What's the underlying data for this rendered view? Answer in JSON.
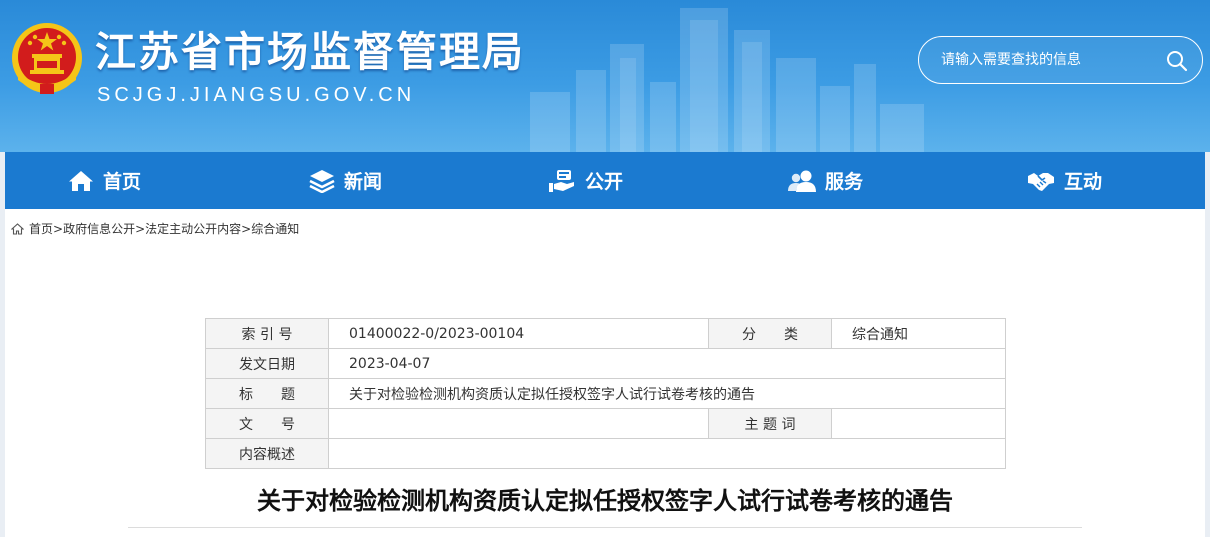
{
  "header": {
    "site_title": "江苏省市场监督管理局",
    "site_domain": "SCJGJ.JIANGSU.GOV.CN",
    "emblem_icon": "national-emblem-icon",
    "search_placeholder": "请输入需要查找的信息",
    "search_icon": "search-icon"
  },
  "nav": {
    "items": [
      {
        "label": "首页",
        "icon": "home-icon"
      },
      {
        "label": "新闻",
        "icon": "layers-icon"
      },
      {
        "label": "公开",
        "icon": "open-hand-icon"
      },
      {
        "label": "服务",
        "icon": "users-icon"
      },
      {
        "label": "互动",
        "icon": "handshake-icon"
      }
    ]
  },
  "breadcrumb": {
    "icon": "home-icon",
    "items": [
      "首页",
      "政府信息公开",
      "法定主动公开内容",
      "综合通知"
    ],
    "separator": ">"
  },
  "info_table": {
    "index_label": "索 引 号",
    "index_value": "01400022-0/2023-00104",
    "category_label": "分　　类",
    "category_value": "综合通知",
    "date_label": "发文日期",
    "date_value": "2023-04-07",
    "title_label": "标　　题",
    "title_value": "关于对检验检测机构资质认定拟任授权签字人试行试卷考核的通告",
    "doc_no_label": "文　　号",
    "doc_no_value": "",
    "keywords_label": "主 题 词",
    "keywords_value": "",
    "summary_label": "内容概述",
    "summary_value": ""
  },
  "article": {
    "title": "关于对检验检测机构资质认定拟任授权签字人试行试卷考核的通告"
  },
  "colors": {
    "header_blue": "#2a8ad8",
    "nav_blue": "#1b7ad0",
    "emblem_red": "#d21c1c",
    "emblem_gold": "#f5c518"
  }
}
